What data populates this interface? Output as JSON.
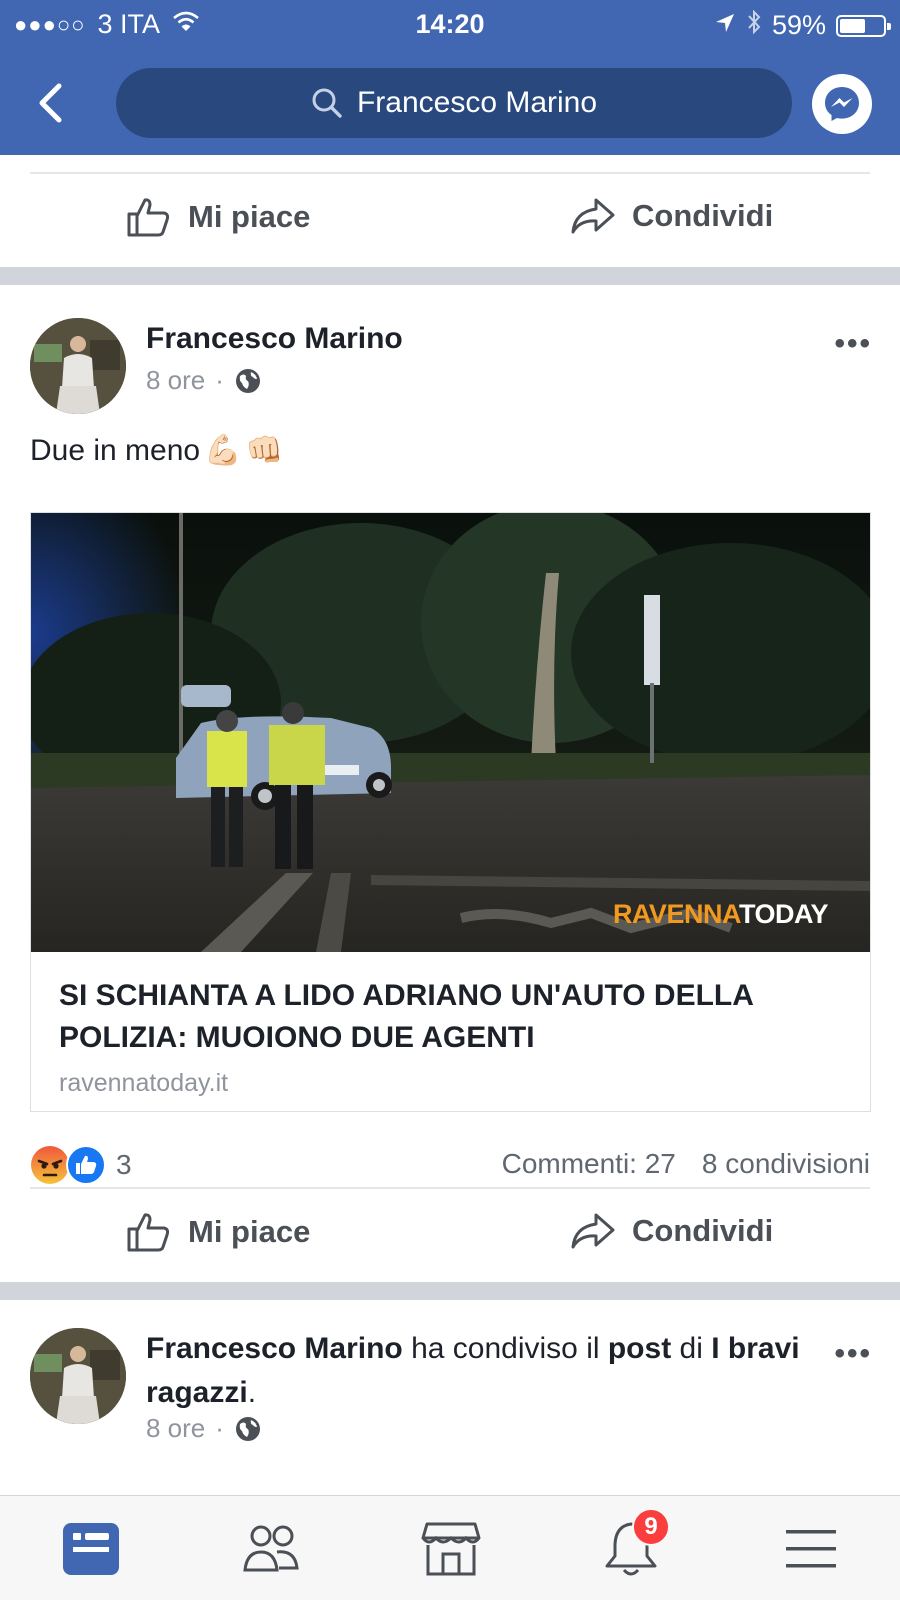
{
  "status_bar": {
    "signal_dots": "●●●○○",
    "carrier": "3 ITA",
    "time": "14:20",
    "battery": "59%",
    "battery_level": 0.59
  },
  "header": {
    "search_text": "Francesco Marino",
    "back_icon": "chevron-left-icon",
    "messenger_icon": "messenger-icon"
  },
  "colors": {
    "brand_blue": "#4267b2",
    "search_blue": "#29487d",
    "badge_red": "#fa3e3e",
    "link_watermark_orange": "#f29a1f"
  },
  "prev_post_actions": {
    "like_label": "Mi piace",
    "share_label": "Condividi"
  },
  "post": {
    "author": "Francesco Marino",
    "time": "8 ore",
    "separator": "·",
    "audience_icon": "globe-icon",
    "more": "•••",
    "text": "Due in meno",
    "emoji": [
      "💪🏻",
      "👊🏻"
    ],
    "link": {
      "watermark_part1": "RAVENNA",
      "watermark_part2": "TODAY",
      "title": "SI SCHIANTA A LIDO ADRIANO UN'AUTO DELLA POLIZIA: MUOIONO DUE AGENTI",
      "domain": "ravennatoday.it"
    },
    "reaction_count": "3",
    "comments": "Commenti: 27",
    "shares": "8 condivisioni",
    "actions": {
      "like_label": "Mi piace",
      "share_label": "Condividi"
    }
  },
  "next_post": {
    "author": "Francesco Marino",
    "verb": " ha condiviso il ",
    "object": "post",
    "of": " di ",
    "page_name": "I bravi ragazzi",
    "end": ".",
    "time": "8 ore",
    "separator": "·",
    "more": "•••"
  },
  "tabbar": {
    "tabs": [
      "news-feed-icon",
      "friends-icon",
      "marketplace-icon",
      "notifications-icon",
      "menu-icon"
    ],
    "notifications_badge": "9"
  }
}
